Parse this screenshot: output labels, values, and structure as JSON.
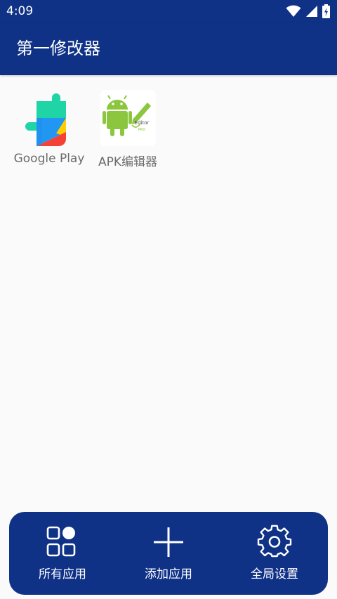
{
  "status_bar": {
    "time": "4:09",
    "icons": [
      "wifi-icon",
      "signal-icon",
      "battery-charging-icon"
    ]
  },
  "header": {
    "title": "第一修改器"
  },
  "apps": [
    {
      "label": "Google Play",
      "icon": "google-play-services-icon"
    },
    {
      "label": "APK编辑器",
      "icon": "apk-editor-icon",
      "icon_text": "Editor\nPRO"
    }
  ],
  "bottom_nav": {
    "items": [
      {
        "label": "所有应用",
        "icon": "apps-grid-icon"
      },
      {
        "label": "添加应用",
        "icon": "plus-icon"
      },
      {
        "label": "全局设置",
        "icon": "gear-icon"
      }
    ]
  },
  "colors": {
    "primary": "#0f3287",
    "background": "#fafafa",
    "label_text": "#6b6b6b",
    "android_green": "#8cc63f"
  }
}
